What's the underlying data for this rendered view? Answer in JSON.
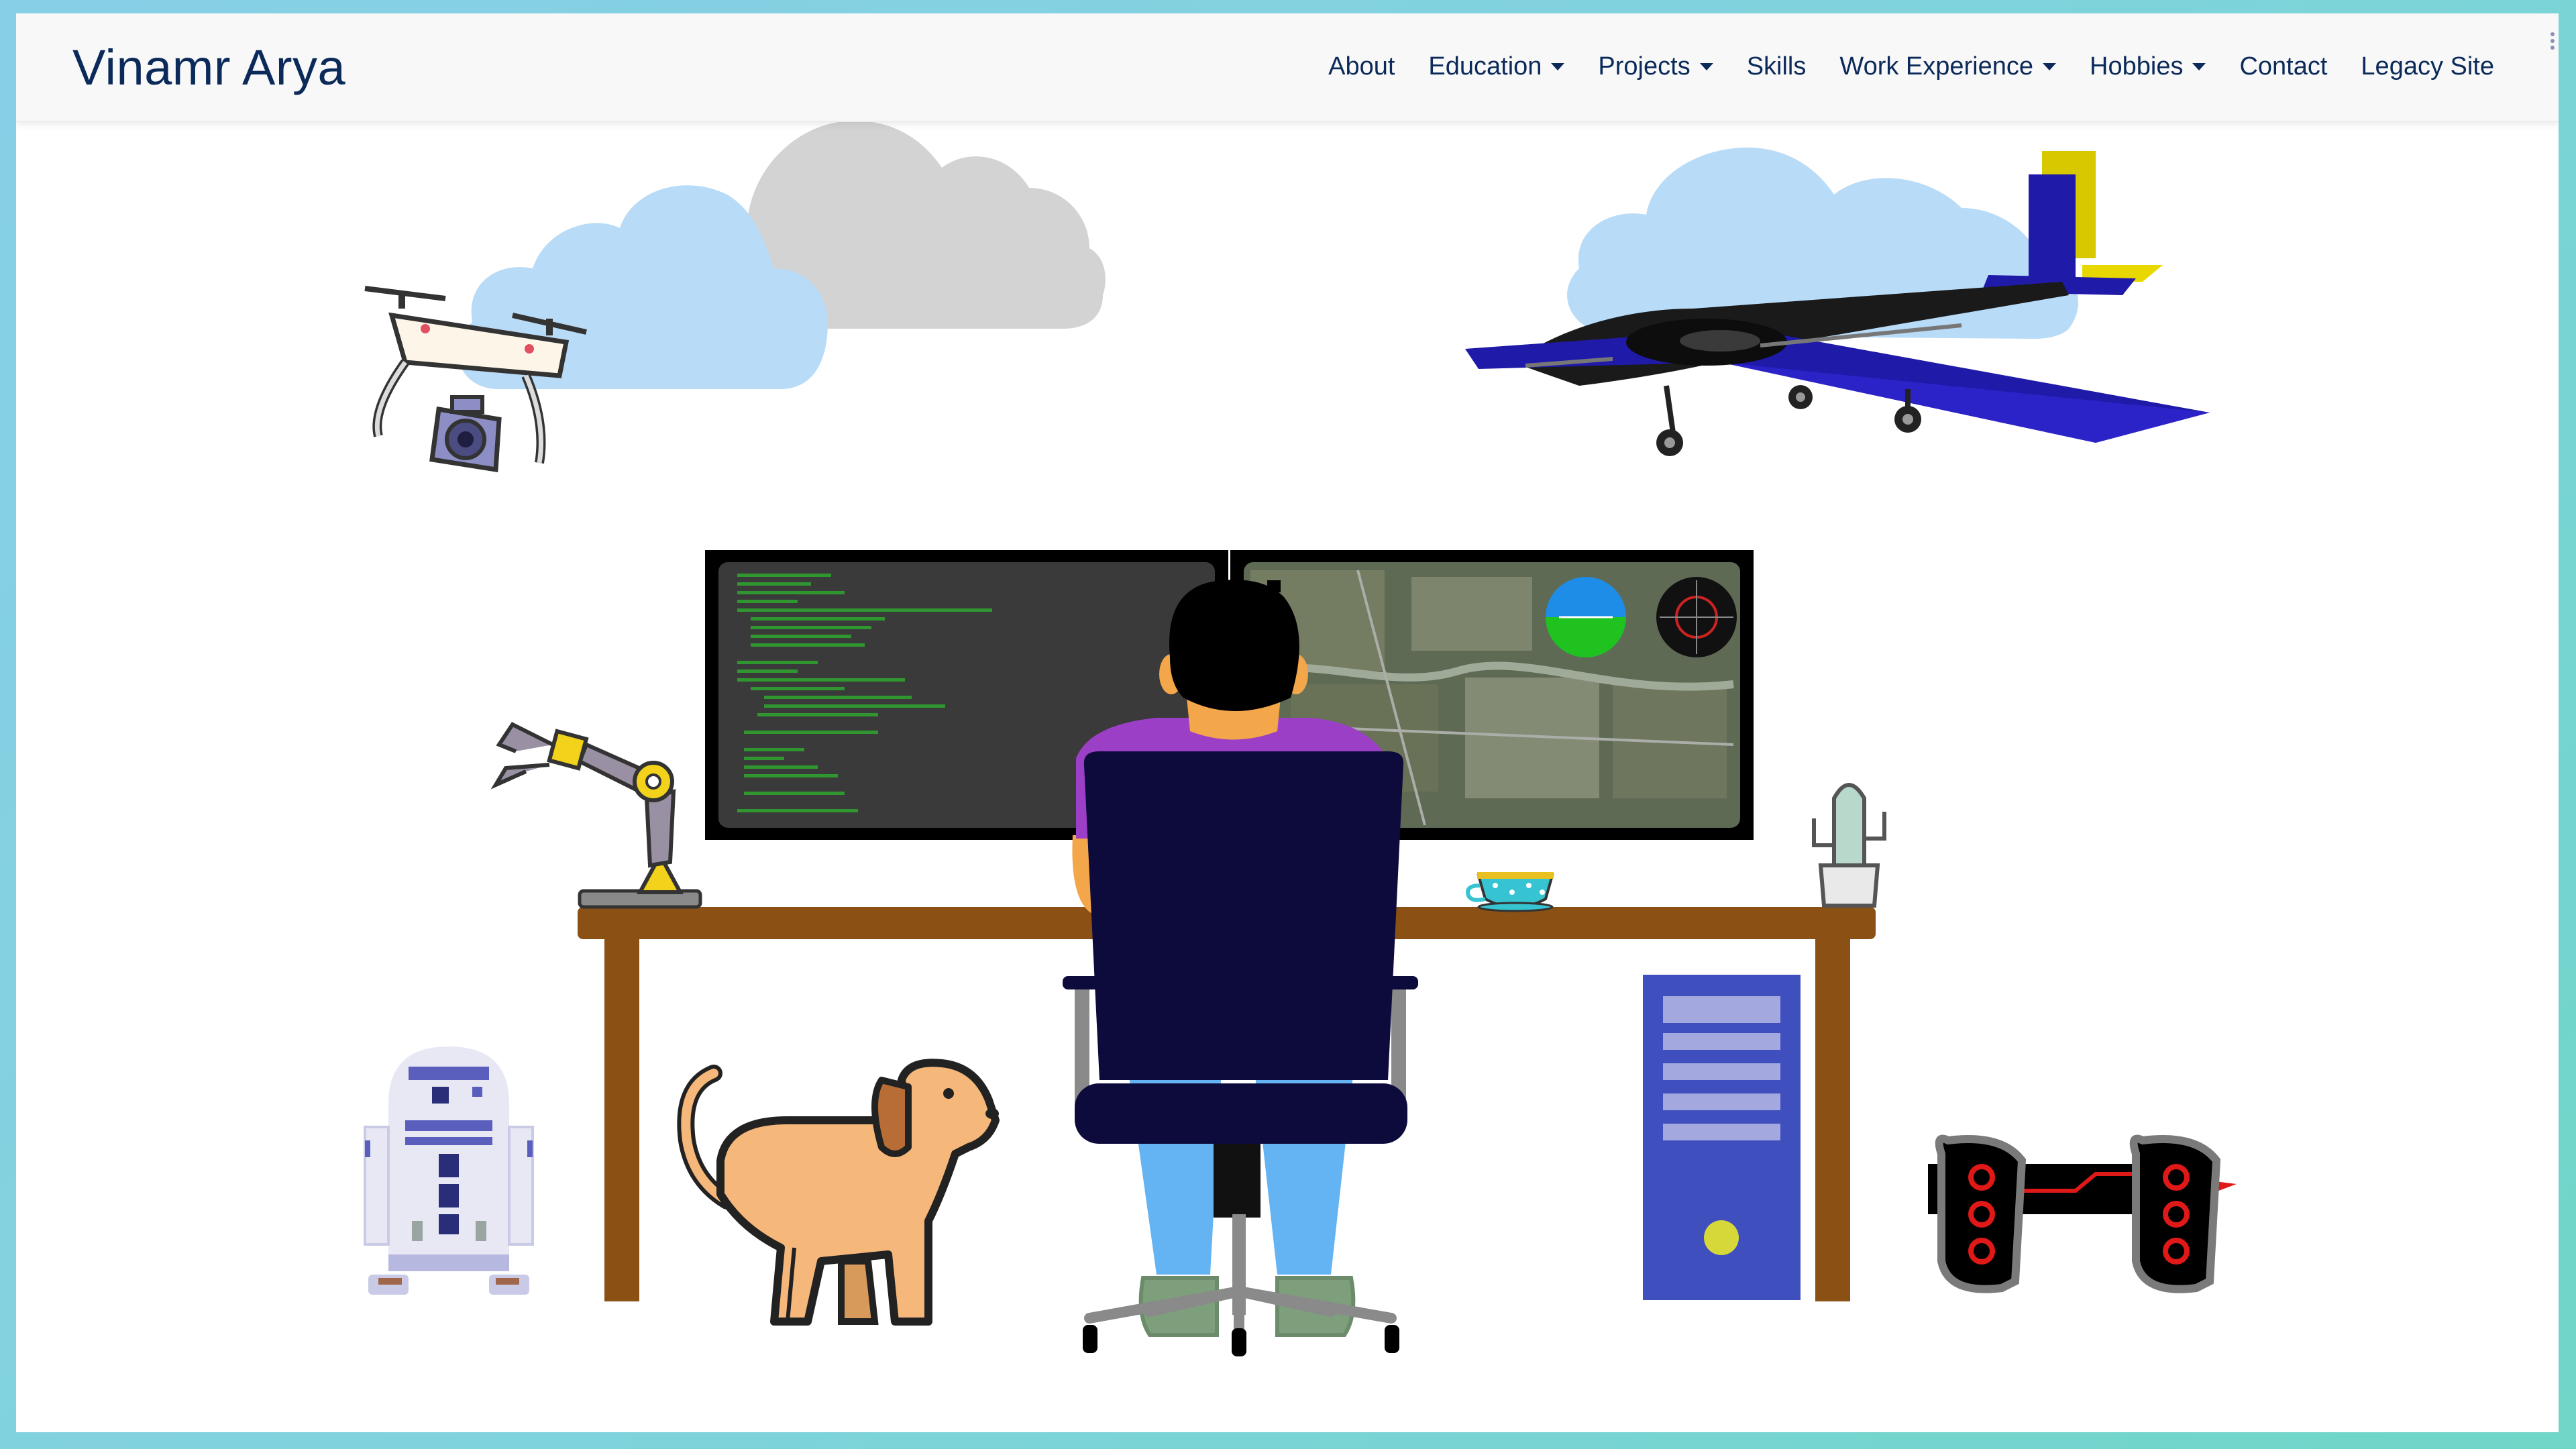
{
  "brand": "Vinamr Arya",
  "nav": [
    {
      "label": "About",
      "dropdown": false
    },
    {
      "label": "Education",
      "dropdown": true
    },
    {
      "label": "Projects",
      "dropdown": true
    },
    {
      "label": "Skills",
      "dropdown": false
    },
    {
      "label": "Work Experience",
      "dropdown": true
    },
    {
      "label": "Hobbies",
      "dropdown": true
    },
    {
      "label": "Contact",
      "dropdown": false
    },
    {
      "label": "Legacy Site",
      "dropdown": false
    }
  ],
  "colors": {
    "brand_text": "#0b2a5a",
    "sky_cloud": "#b8dbf7",
    "grey_cloud": "#d3d3d3",
    "desk": "#8b5114",
    "chair": "#0d0b3c",
    "shirt": "#9b3fc7",
    "pants": "#64b3f2",
    "pc_tower": "#3f4fbd",
    "plane_wing": "#1f1aa8"
  },
  "illustrations": [
    "drone-icon",
    "airplane-icon",
    "robot-arm-icon",
    "r2d2-icon",
    "dog-icon",
    "pc-tower-icon",
    "rover-icon",
    "cactus-icon",
    "teacup-icon",
    "monitor-code",
    "monitor-map"
  ]
}
